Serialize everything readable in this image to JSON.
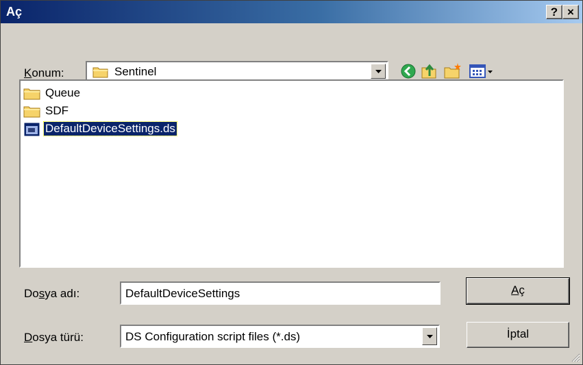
{
  "window": {
    "title": "Aç",
    "help_label": "?",
    "close_label": "×"
  },
  "location": {
    "label_prefix": "K",
    "label_rest": "onum:",
    "folder": "Sentinel"
  },
  "toolbar": {
    "icons": [
      "back-icon",
      "up-folder-icon",
      "new-folder-icon",
      "view-menu-icon"
    ]
  },
  "files": [
    {
      "name": "Queue",
      "type": "folder",
      "selected": false
    },
    {
      "name": "SDF",
      "type": "folder",
      "selected": false
    },
    {
      "name": "DefaultDeviceSettings.ds",
      "type": "file",
      "selected": true
    }
  ],
  "filename": {
    "label_pre": "Do",
    "label_u": "s",
    "label_post": "ya adı:",
    "value": "DefaultDeviceSettings"
  },
  "filetype": {
    "label_u": "D",
    "label_post": "osya türü:",
    "value": "DS Configuration script files (*.ds)"
  },
  "buttons": {
    "open_u": "A",
    "open_rest": "ç",
    "cancel": "İptal"
  }
}
